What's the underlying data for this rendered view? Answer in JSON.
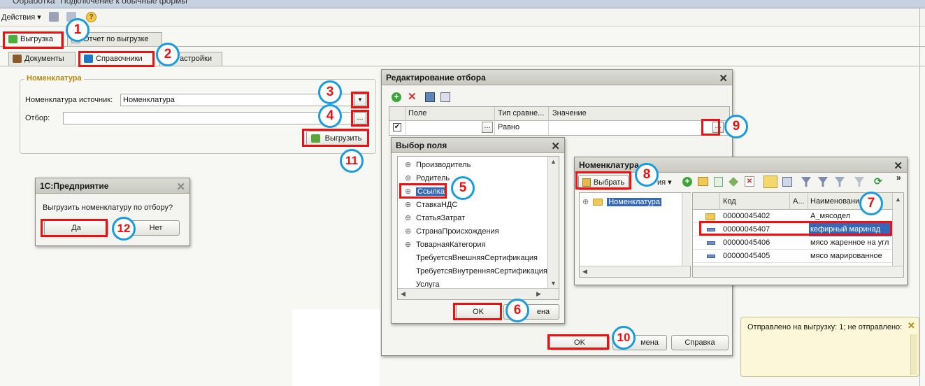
{
  "window": {
    "title": "Обработка \"Подключение к обычные формы\""
  },
  "toolbar": {
    "actions_label": "Действия",
    "help_label": "?"
  },
  "tabs_main": [
    {
      "label": "Выгрузка"
    },
    {
      "label": "Отчет по выгрузке"
    }
  ],
  "tabs_sub": [
    {
      "label": "Документы"
    },
    {
      "label": "Справочники"
    },
    {
      "label": "Настройки",
      "shown": "астройки"
    }
  ],
  "nomenclature_group": {
    "legend": "Номенклатура",
    "source_label": "Номенклатура источник:",
    "source_value": "Номенклатура",
    "filter_label": "Отбор:",
    "filter_value": "",
    "export_button": "Выгрузить",
    "dropdown_glyph": "▼",
    "ellipsis": "..."
  },
  "dialog_confirm": {
    "title": "1С:Предприятие",
    "message": "Выгрузить номенклатуру по отбору?",
    "yes": "Да",
    "no": "Нет"
  },
  "dialog_filter": {
    "title": "Редактирование отбора",
    "columns": [
      "Поле",
      "Тип сравне...",
      "Значение"
    ],
    "row": {
      "field": "",
      "compare": "Равно",
      "value": ""
    },
    "ok": "OK",
    "cancel": "Отмена",
    "cancel_visible": "мена",
    "help": "Справка"
  },
  "dialog_field_select": {
    "title": "Выбор поля",
    "items": [
      {
        "label": "Производитель",
        "expandable": true
      },
      {
        "label": "Родитель",
        "expandable": true
      },
      {
        "label": "Ссылка",
        "expandable": true,
        "selected": true
      },
      {
        "label": "СтавкаНДС",
        "expandable": true
      },
      {
        "label": "СтатьяЗатрат",
        "expandable": true
      },
      {
        "label": "СтранаПроисхождения",
        "expandable": true
      },
      {
        "label": "ТоварнаяКатегория",
        "expandable": true
      },
      {
        "label": "ТребуетсяВнешняяСертификация",
        "expandable": false
      },
      {
        "label": "ТребуетсяВнутренняяСертификация",
        "expandable": false
      },
      {
        "label": "Услуга",
        "expandable": false
      }
    ],
    "ok": "OK",
    "cancel_visible": "ена"
  },
  "dialog_catalog": {
    "title": "Номенклатура",
    "select_button": "Выбрать",
    "actions_partial": "ия",
    "tree_root": "Номенклатура",
    "columns": [
      "Код",
      "А...",
      "Наименование"
    ],
    "rows": [
      {
        "code": "00000045402",
        "name": "А_мясодел",
        "folder": true
      },
      {
        "code": "00000045407",
        "name": "кефирный маринад",
        "selected": true
      },
      {
        "code": "00000045406",
        "name": "мясо жаренное на угл"
      },
      {
        "code": "00000045405",
        "name": "мясо марированное"
      }
    ]
  },
  "notification": {
    "text": "Отправлено на выгрузку: 1; не отправлено:"
  },
  "annotations": [
    "1",
    "2",
    "3",
    "4",
    "5",
    "6",
    "7",
    "8",
    "9",
    "10",
    "11",
    "12"
  ],
  "colors": {
    "annotation_red": "#ee1111",
    "annotation_blue": "#1a9bde",
    "selection": "#3569b8",
    "group_legend": "#b8860b"
  }
}
